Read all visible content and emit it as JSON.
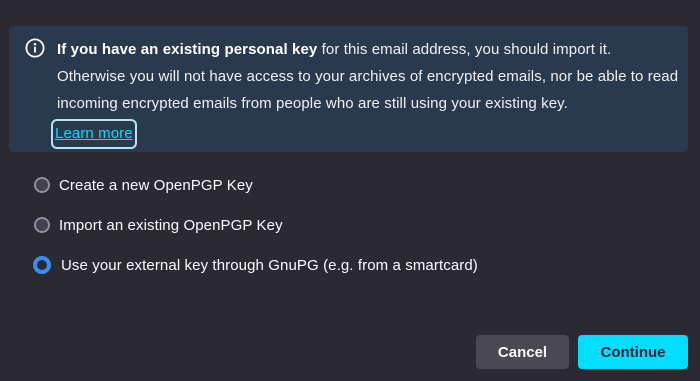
{
  "notice": {
    "bold_text": "If you have an existing personal key",
    "text_part1": " for this email address, you should import it. Otherwise you will not have access to your archives of encrypted emails, nor be able to read incoming encrypted emails from people who are still using your existing key.",
    "learn_more": "Learn more",
    "icon": "info-icon"
  },
  "options": [
    {
      "label": "Create a new OpenPGP Key",
      "checked": false
    },
    {
      "label": "Import an existing OpenPGP Key",
      "checked": false
    },
    {
      "label": "Use your external key through GnuPG (e.g. from a smartcard)",
      "checked": true
    }
  ],
  "buttons": {
    "cancel": "Cancel",
    "continue": "Continue"
  },
  "colors": {
    "background": "#2b2a33",
    "notice_background": "#2a3a4e",
    "accent": "#00ddff",
    "radio_checked": "#3a8df8"
  }
}
